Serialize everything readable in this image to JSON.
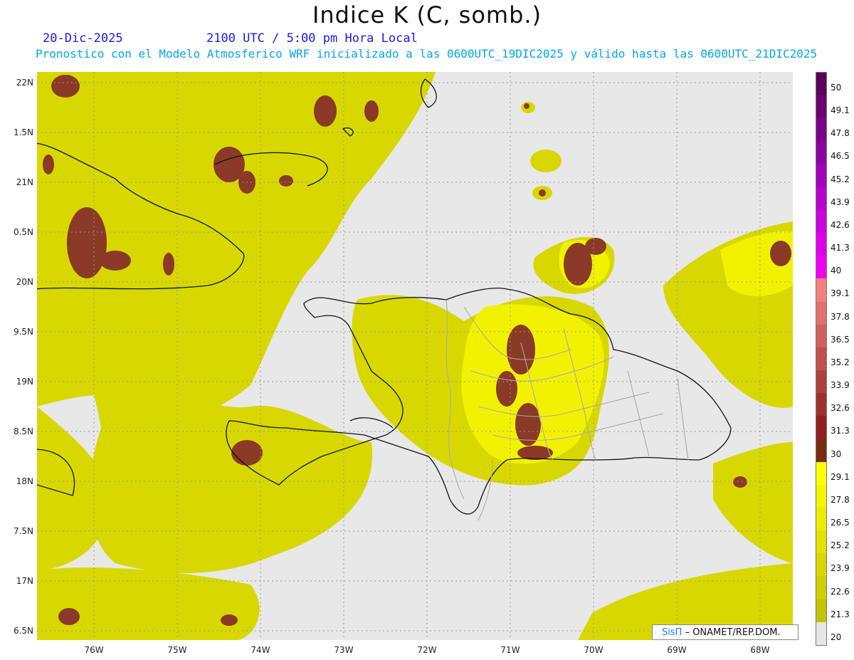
{
  "title": "Indice K (C, somb.)",
  "header": {
    "date": "20-Dic-2025",
    "time": "2100 UTC / 5:00 pm Hora Local",
    "description": "Pronostico con el Modelo Atmosferico WRF inicializado a las 0600UTC_19DIC2025 y válido hasta las  0600UTC_21DIC2025"
  },
  "lat_labels": [
    "22N",
    "1.5N",
    "21N",
    "0.5N",
    "20N",
    "9.5N",
    "19N",
    "8.5N",
    "18N",
    "7.5N",
    "17N",
    "6.5N"
  ],
  "lon_labels": [
    "76W",
    "75W",
    "74W",
    "73W",
    "72W",
    "71W",
    "70W",
    "69W",
    "68W"
  ],
  "colorbar": {
    "labels": [
      "50",
      "49.1",
      "47.8",
      "46.5",
      "45.2",
      "43.9",
      "42.6",
      "41.3",
      "40",
      "39.1",
      "37.8",
      "36.5",
      "35.2",
      "33.9",
      "32.6",
      "31.3",
      "30",
      "29.1",
      "27.8",
      "26.5",
      "25.2",
      "23.9",
      "22.6",
      "21.3",
      "20"
    ],
    "colors": [
      "#5a005a",
      "#6a0070",
      "#7a0088",
      "#8c00a0",
      "#a000b8",
      "#b800cc",
      "#cc00dd",
      "#e000e8",
      "#f000f0",
      "#f08080",
      "#e07070",
      "#d06060",
      "#c05050",
      "#b04040",
      "#a03030",
      "#902020",
      "#7a2a10",
      "#ffff00",
      "#f5f500",
      "#ecec00",
      "#e2e200",
      "#d8d800",
      "#cece00",
      "#c4c400",
      "#e6e6e6"
    ]
  },
  "credit": {
    "brand": "SisΠ",
    "text": "– ONAMET/REP.DOM."
  }
}
